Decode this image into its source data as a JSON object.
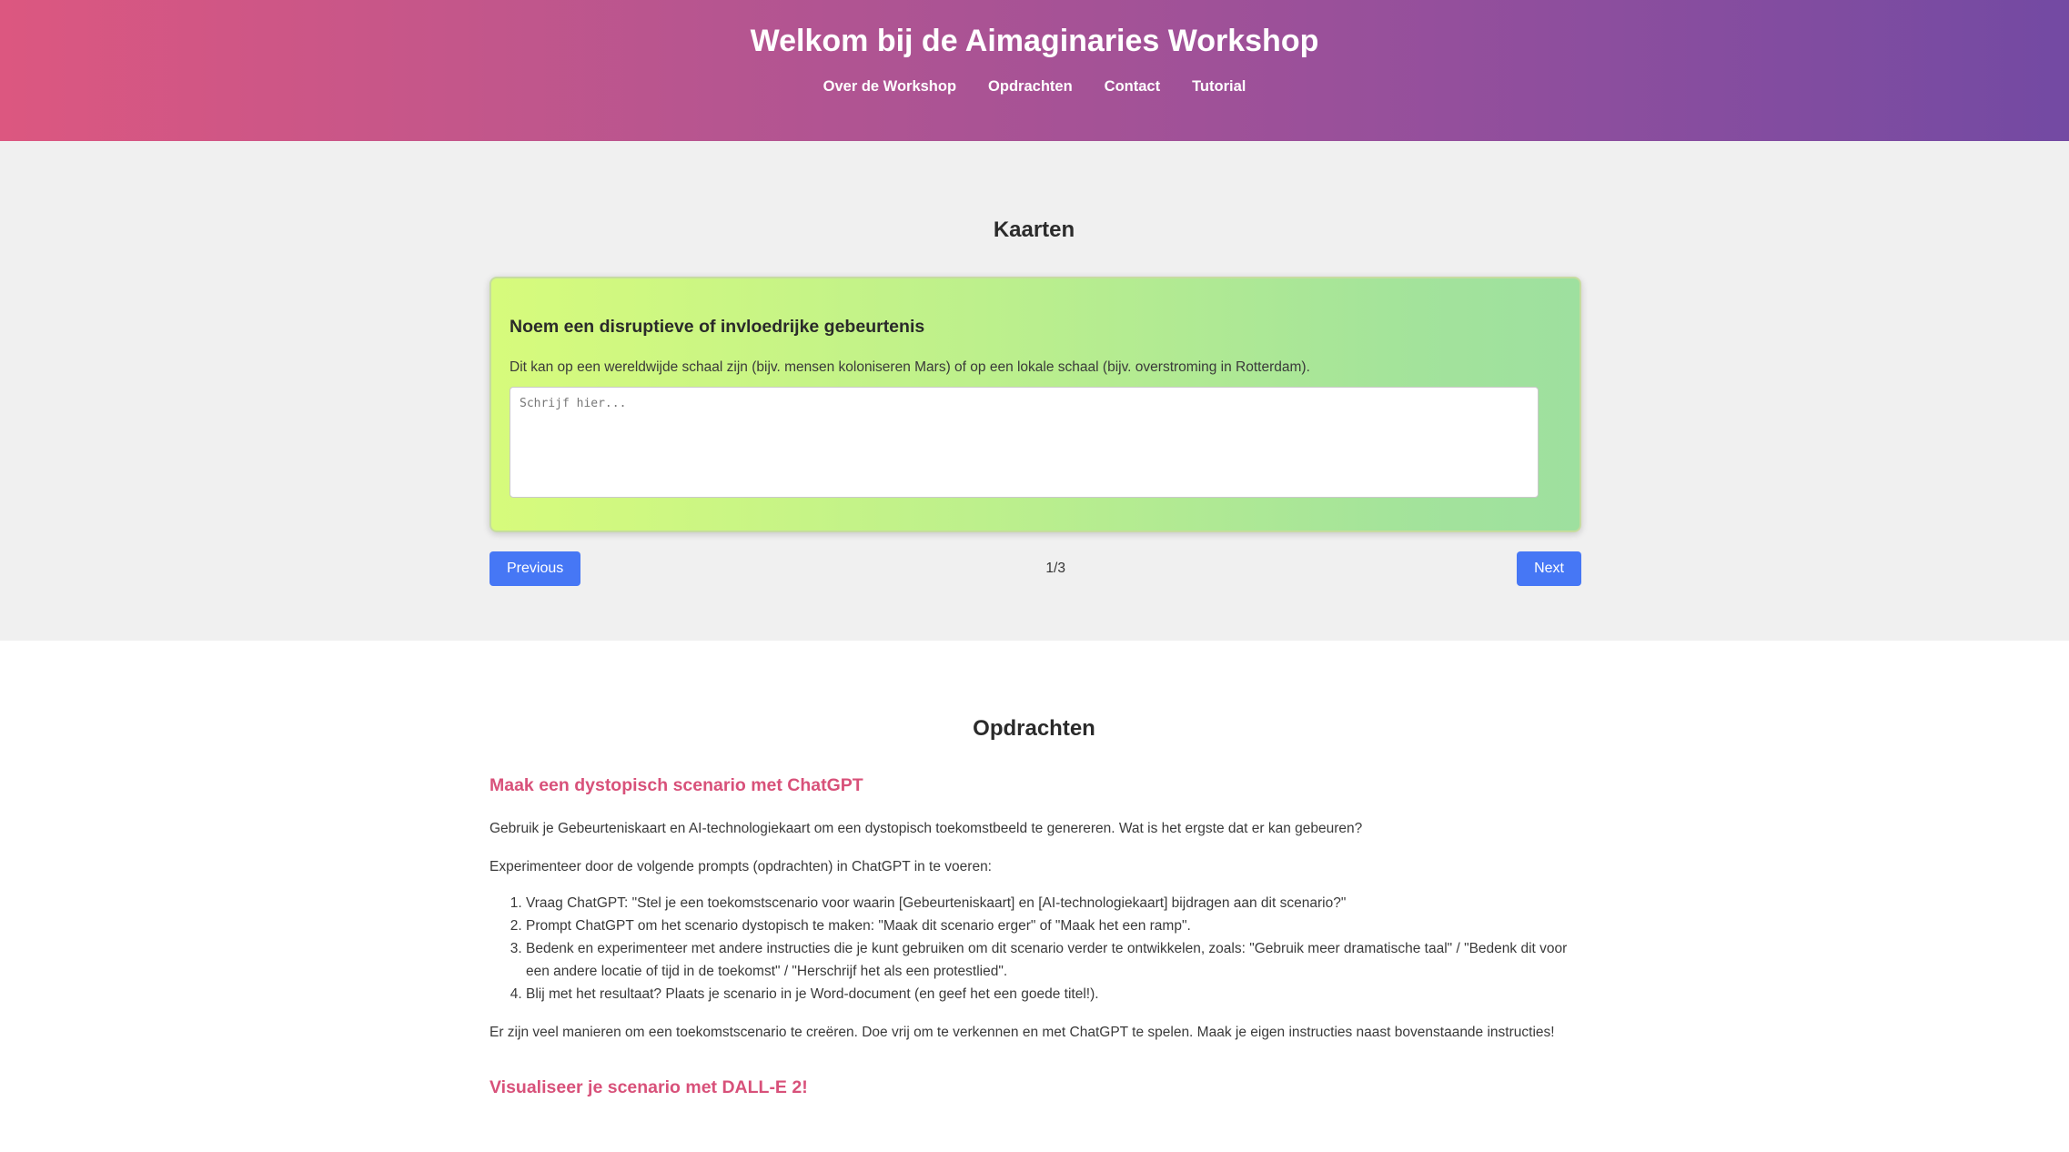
{
  "header": {
    "title": "Welkom bij de Aimaginaries Workshop",
    "nav": [
      "Over de Workshop",
      "Opdrachten",
      "Contact",
      "Tutorial"
    ]
  },
  "kaarten": {
    "title": "Kaarten",
    "card": {
      "heading": "Noem een disruptieve of invloedrijke gebeurtenis",
      "description": "Dit kan op een wereldwijde schaal zijn (bijv. mensen koloniseren Mars) of op een lokale schaal (bijv. overstroming in Rotterdam).",
      "textarea_placeholder": "Schrijf hier...",
      "textarea_value": ""
    },
    "previous_label": "Previous",
    "next_label": "Next",
    "page_indicator": "1/3"
  },
  "opdrachten": {
    "title": "Opdrachten",
    "assignment1": {
      "title": "Maak een dystopisch scenario met ChatGPT",
      "intro": "Gebruik je Gebeurteniskaart en AI-technologiekaart om een dystopisch toekomstbeeld te genereren. Wat is het ergste dat er kan gebeuren?",
      "experiment": "Experimenteer door de volgende prompts (opdrachten) in ChatGPT in te voeren:",
      "steps": [
        "Vraag ChatGPT: \"Stel je een toekomstscenario voor waarin [Gebeurteniskaart] en [AI-technologiekaart] bijdragen aan dit scenario?\"",
        "Prompt ChatGPT om het scenario dystopisch te maken: \"Maak dit scenario erger\" of \"Maak het een ramp\".",
        "Bedenk en experimenteer met andere instructies die je kunt gebruiken om dit scenario verder te ontwikkelen, zoals: \"Gebruik meer dramatische taal\" / \"Bedenk dit voor een andere locatie of tijd in de toekomst\" / \"Herschrijf het als een protestlied\".",
        "Blij met het resultaat? Plaats je scenario in je Word-document (en geef het een goede titel!)."
      ],
      "outro": "Er zijn veel manieren om een toekomstscenario te creëren. Doe vrij om te verkennen en met ChatGPT te spelen. Maak je eigen instructies naast bovenstaande instructies!"
    },
    "assignment2": {
      "title": "Visualiseer je scenario met DALL-E 2!"
    }
  },
  "colors": {
    "header_gradient_start": "#dc5780",
    "header_gradient_end": "#734aa3",
    "button": "#4677f5",
    "assignment_title": "#d8517a",
    "card_gradient_start": "#d7fb7c",
    "card_gradient_end": "#9ee09f"
  }
}
